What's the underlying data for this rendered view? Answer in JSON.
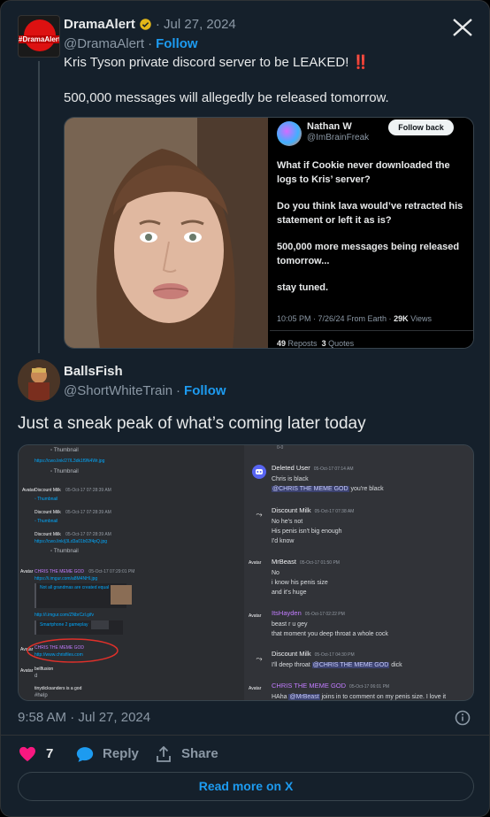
{
  "tweet": {
    "author_name": "DramaAlert",
    "avatar_brand": "#DramaAlert",
    "date": "· Jul 27, 2024",
    "handle": "@DramaAlert",
    "follow": "Follow",
    "line1": "Kris Tyson private discord server to be LEAKED! ‼️",
    "line2": "500,000 messages will allegedly be released tomorrow."
  },
  "quoted": {
    "name": "Nathan W",
    "handle": "@ImBrainFreak",
    "follow_back": "Follow back",
    "p1": "What if Cookie never downloaded the logs to Kris’ server?",
    "p2": "Do you think lava would’ve retracted his statement or left it as is?",
    "p3": "500,000 more messages being released tomorrow...",
    "p4": "stay tuned.",
    "meta_time": "10:05 PM · 7/26/24 From Earth ·",
    "meta_views": "29K",
    "meta_views_label": "Views",
    "reposts": "49",
    "reposts_label": "Reposts",
    "quotes": "3",
    "quotes_label": "Quotes"
  },
  "reply": {
    "name": "BallsFish",
    "handle": "@ShortWhiteTrain",
    "follow": "Follow",
    "text": "Just a sneak peak of what’s coming later today"
  },
  "discord_left": {
    "thumbnail": "Thumbnail",
    "link1": "https://cwo.link/27/L3dk1f9N4Wr.jpg",
    "user_milk": "Discount Milk",
    "t1": "05-Oct-17 07:28:39 AM",
    "t2": "05-Oct-17 07:28:39 AM",
    "t3": "05-Oct-17 07:28:39 AM",
    "link2": "https://cwo.link/j3Ld3a01b02f4pQ.jpg",
    "chris": "CHRIS THE MEME GOD",
    "chris_time": "05-Oct-17 07:29:01 PM",
    "link3": "https://i.imgur.com/a8M4NHI.jpg",
    "all_grandmas": "Not all grandmas are created equal",
    "link4": "http://i.imgur.com/ZNbrCzl.gifv",
    "smartphone": "Smartphone 2 gameplay",
    "chris2": "CHRIS THE MEME GOD",
    "chris2_link": "http://www.chrisfiles.com",
    "bellfusion": "bellfusion",
    "d": "d",
    "tinydick": "tinydicksanders is a god",
    "help": "#help",
    "avatar_label": "Avatar"
  },
  "discord_right": {
    "top": "0-0",
    "m1_name": "Deleted User",
    "m1_time": "05-Oct-17 07:14 AM",
    "m1_l1": "Chris is black",
    "m1_mention": "@CHRIS THE MEME GOD",
    "m1_l2": "you're black",
    "m2_name": "Discount Milk",
    "m2_time": "05-Oct-17 07:38 AM",
    "m2_l1": "No he's not",
    "m2_l2": "His penis isn't big enough",
    "m2_l3": "I'd know",
    "m3_name": "MrBeast",
    "m3_time": "05-Oct-17 01:50 PM",
    "m3_l1": "No",
    "m3_l2": "i know his penis size",
    "m3_l3": "and it's huge",
    "m4_name": "ItsHayden",
    "m4_time": "05-Oct-17 02:22 PM",
    "m4_l1": "beast r u gey",
    "m4_l2": "that moment you deep throat a whole cock",
    "m5_name": "Discount Milk",
    "m5_time": "05-Oct-17 04:30 PM",
    "m5_pre": "I'll deep throat",
    "m5_mention": "@CHRIS THE MEME GOD",
    "m5_post": "dick",
    "m6_name": "CHRIS THE MEME GOD",
    "m6_time": "05-Oct-17 06:01 PM",
    "m6_pre": "HAha",
    "m6_mention": "@MrBeast",
    "m6_post": "joins in to comment on my penis size. I love it",
    "avatar_label": "Avatar"
  },
  "footer": {
    "timestamp": "9:58 AM · Jul 27, 2024",
    "likes": "7",
    "reply": "Reply",
    "share": "Share",
    "read_more": "Read more on X"
  },
  "colors": {
    "accent": "#1d9bf0",
    "like": "#f91880",
    "background": "#15202b",
    "highlight_circle": "#e0302a"
  }
}
